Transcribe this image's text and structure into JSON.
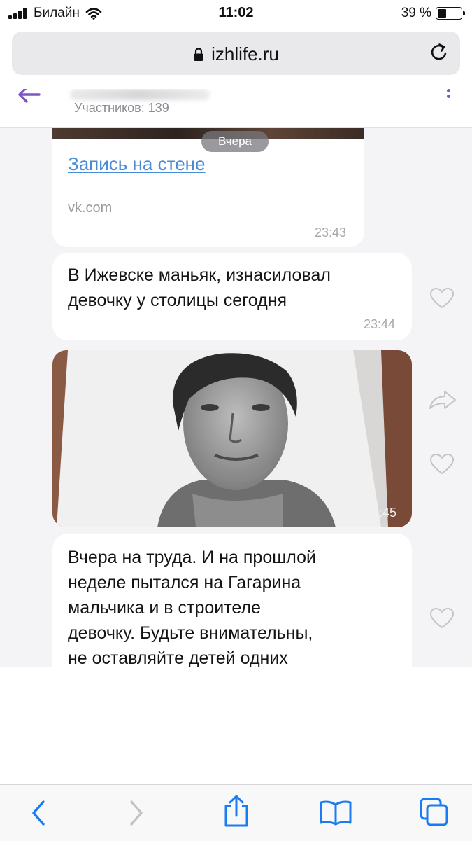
{
  "status_bar": {
    "carrier": "Билайн",
    "time": "11:02",
    "battery_percent": "39 %",
    "battery_level": 0.39
  },
  "safari": {
    "address": "izhlife.ru"
  },
  "chat": {
    "members": "Участников: 139",
    "day_separator": "Вчера",
    "messages": [
      {
        "type": "link",
        "link_text": "Запись на стене",
        "domain": "vk.com",
        "time": "23:43"
      },
      {
        "type": "text",
        "lines": [
          "В Ижевске маньяк, изнасиловал",
          "девочку у столицы сегодня"
        ],
        "time": "23:44"
      },
      {
        "type": "photo",
        "time": "23:45"
      },
      {
        "type": "text",
        "lines": [
          "Вчера на труда. И на прошлой",
          "неделе пытался на Гагарина",
          "мальчика и в строителе",
          "девочку. Будьте внимательны,",
          "не оставляйте детей одних"
        ]
      }
    ]
  },
  "colors": {
    "accent": "#7b57c4",
    "link": "#4a8bd6",
    "safari_blue": "#1a7cf2",
    "bubble": "#ffffff",
    "chat_bg": "#f4f4f6"
  },
  "icons": [
    "cellular-signal-icon",
    "wifi-icon",
    "battery-icon",
    "lock-icon",
    "reload-icon",
    "back-arrow-icon",
    "more-options-icon",
    "heart-icon",
    "share-icon",
    "back-icon",
    "forward-icon",
    "share-icon",
    "bookmarks-icon",
    "tabs-icon"
  ]
}
